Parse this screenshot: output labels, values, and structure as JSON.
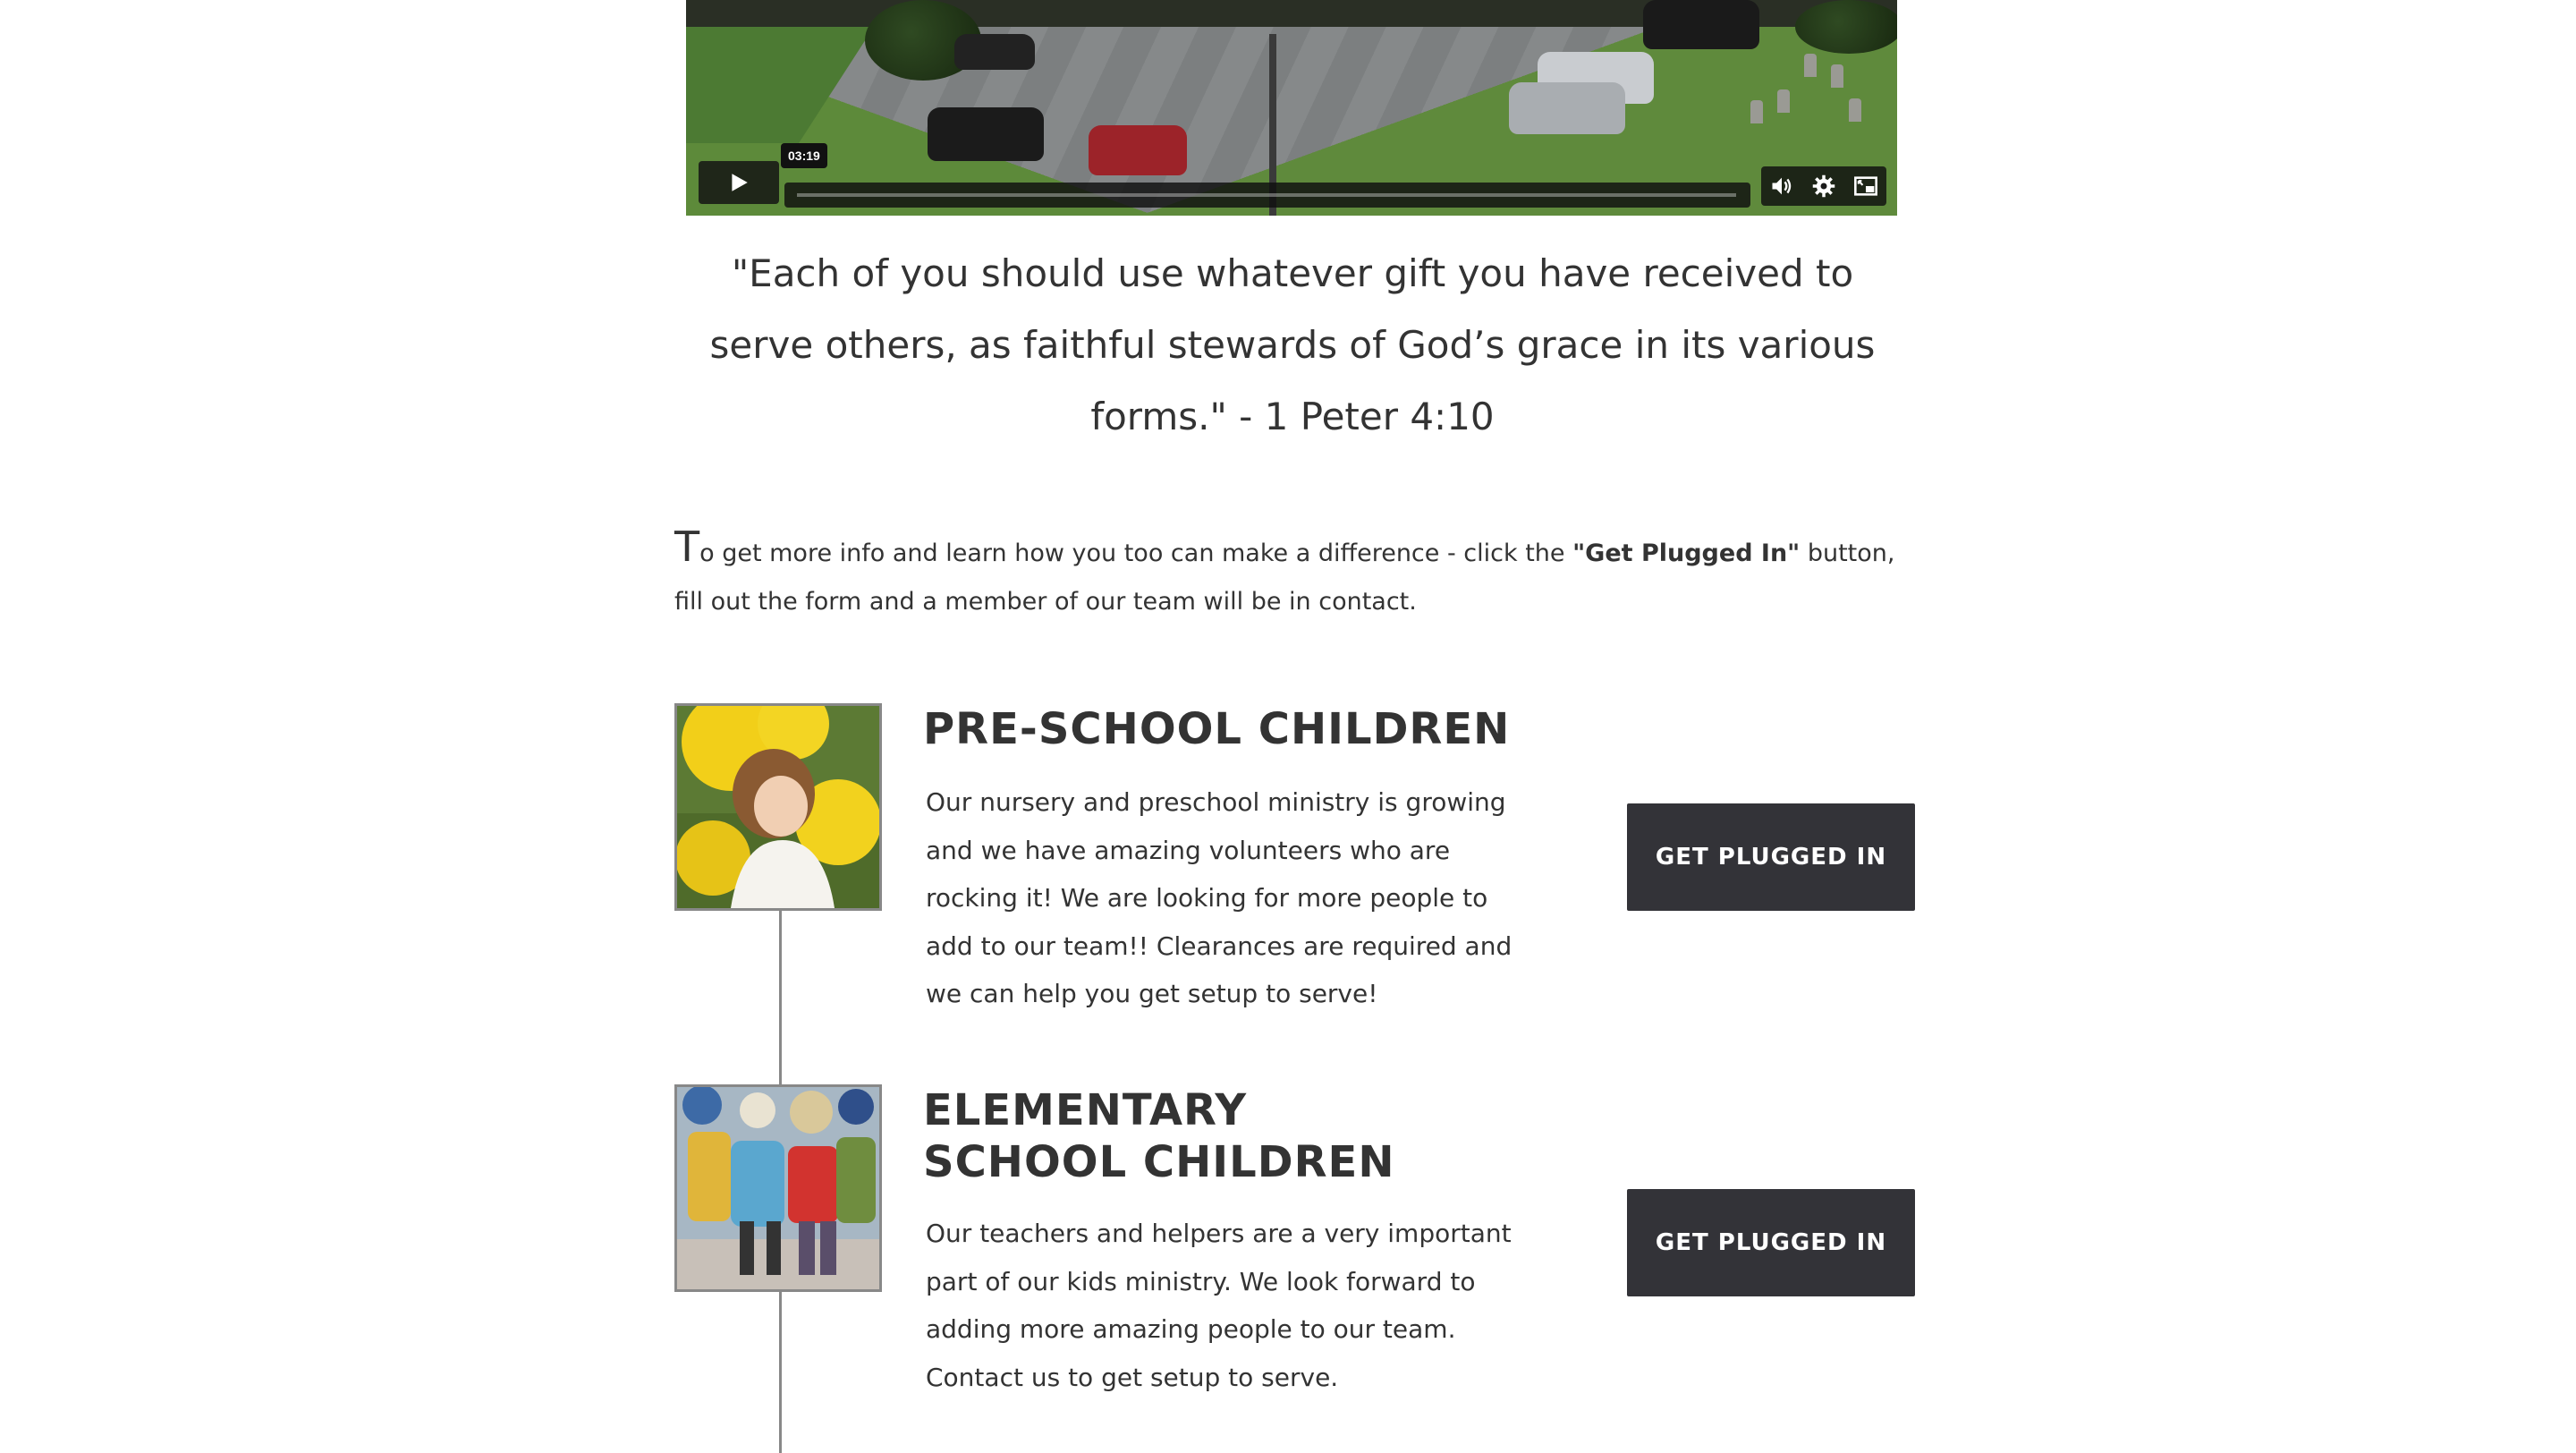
{
  "video": {
    "time_tooltip": "03:19",
    "controls": [
      "play-icon",
      "volume-icon",
      "gear-icon",
      "picture-in-picture-icon"
    ]
  },
  "quote": {
    "text": "\"Each of you should use whatever gift you have received to serve others, as faithful stewards of God’s grace in its various forms.\" - 1 Peter 4:10"
  },
  "intro": {
    "dropcap": "T",
    "text_before": "o get more info and learn how you too can make a difference - click the ",
    "emphasis": "\"Get Plugged In\"",
    "text_after": " button, fill out the form and a member of our team will be in contact."
  },
  "ministries": [
    {
      "title": "PRE-SCHOOL CHILDREN",
      "description": "Our nursery and preschool ministry is growing and we have amazing volunteers who are rocking it! We are looking for more people to add to our team!! Clearances are required and we can help you get setup to serve!",
      "button_label": "GET PLUGGED IN"
    },
    {
      "title": "ELEMENTARY SCHOOL CHILDREN",
      "description": "Our teachers and helpers are a very important part of our kids ministry. We look forward to adding more amazing people to our team. Contact us to get setup to serve.",
      "button_label": "GET PLUGGED IN"
    }
  ],
  "colors": {
    "text": "#333333",
    "button_bg": "#333338",
    "button_text": "#ffffff",
    "timeline_line": "#888888"
  }
}
